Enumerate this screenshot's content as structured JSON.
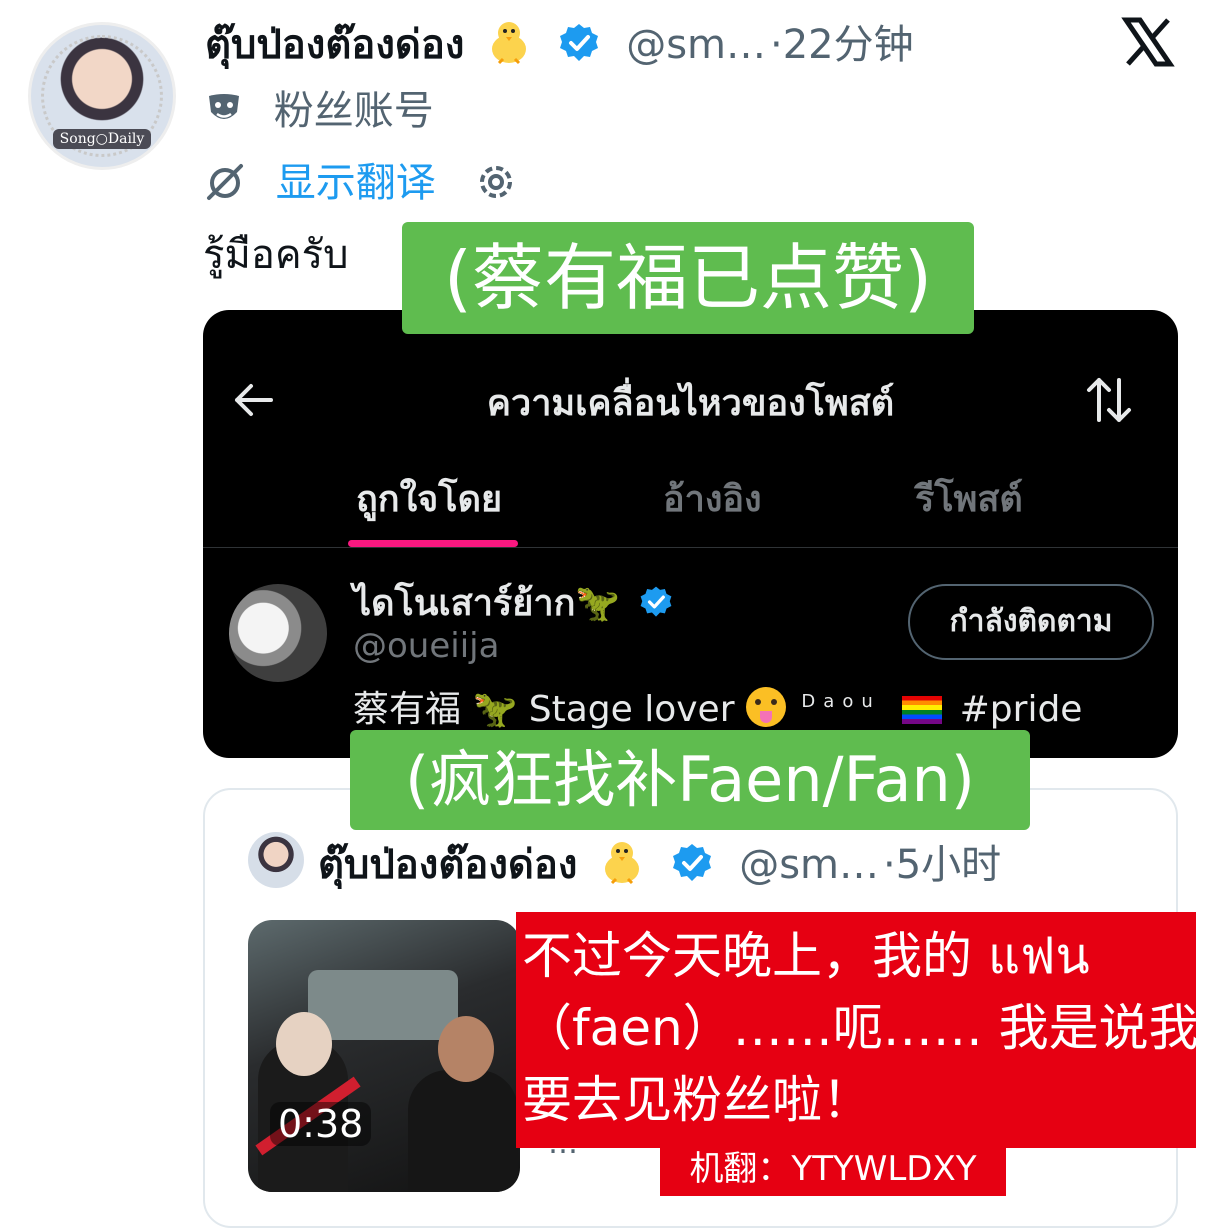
{
  "header": {
    "display_name": "ตุ๊บป่องต๊องด่อง",
    "handle": "@sm…",
    "time": "·22分钟",
    "fan_label": "粉丝账号",
    "translate_label": "显示翻译",
    "avatar_tag": "Song○Daily"
  },
  "tweet": {
    "text": "รู้มือครับ"
  },
  "annotations": {
    "liked": "(蔡有福已点赞)",
    "search": "(疯狂找补Faen/Fan)"
  },
  "embedded": {
    "title": "ความเคลื่อนไหวของโพสต์",
    "tabs": [
      {
        "label": "ถูกใจโดย",
        "active": true
      },
      {
        "label": "อ้างอิง",
        "active": false
      },
      {
        "label": "รีโพสต์",
        "active": false
      }
    ],
    "user": {
      "name": "ไดโนเสาร์ย้าก🦖",
      "handle": "@oueiija",
      "follow_label": "กำลังติดตาม",
      "bio_name": "蔡有福",
      "bio_text": "Stage lover",
      "bio_daou": "Daou",
      "bio_tag": "#pride"
    },
    "accent_color": "#f91880"
  },
  "quoted": {
    "name": "ตุ๊บป่องต๊องด่อง",
    "handle": "@sm…",
    "time": "·5小时",
    "video_time": "0:38",
    "more": "…"
  },
  "subtitle": {
    "lines": [
      "不过今天晚上，我的 แฟน",
      "（faen）……呃…… 我是说我",
      "要去见粉丝啦！"
    ],
    "credit": "机翻：YTYWLDXY"
  },
  "colors": {
    "brand_blue": "#1d9bf0",
    "annotation_green": "#5fbc4f",
    "subtitle_red": "#e60012"
  }
}
